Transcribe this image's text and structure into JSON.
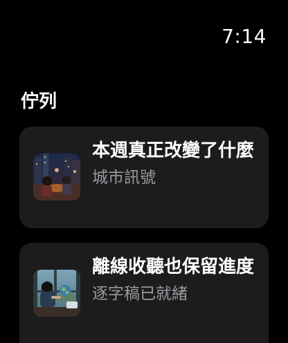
{
  "status": {
    "time": "7:14"
  },
  "queue": {
    "title": "佇列",
    "items": [
      {
        "title": "本週真正改變了什麼",
        "subtitle": "城市訊號",
        "artwork_icon": "city-night-artwork"
      },
      {
        "title": "離線收聽也保留進度",
        "subtitle": "逐字稿已就緒",
        "artwork_icon": "window-scene-artwork"
      }
    ]
  },
  "colors": {
    "background": "#000000",
    "card": "#1c1c1e",
    "text_primary": "#ffffff",
    "text_secondary": "#9a9a9e"
  }
}
